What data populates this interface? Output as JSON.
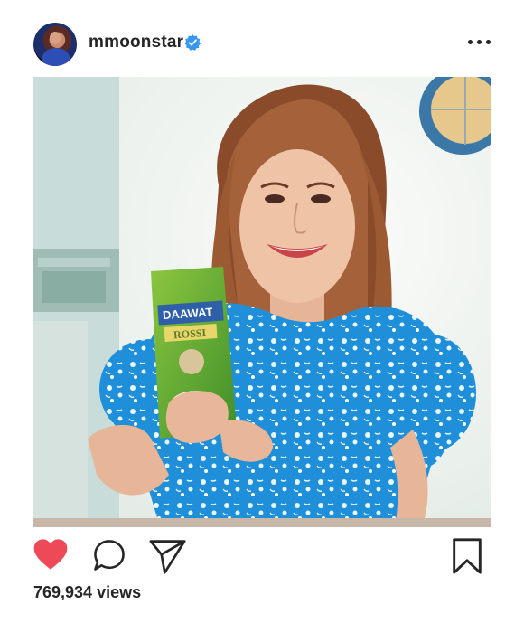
{
  "post": {
    "username": "mmoonstar",
    "verified": true,
    "views_count": "769,934",
    "views_label": "views"
  },
  "media": {
    "brand_text": "DAAWAT",
    "product_text": "ROSSI"
  },
  "icons": {
    "avatar": "profile-avatar",
    "verified": "verified-badge-icon",
    "more": "more-options-icon",
    "like": "heart-icon",
    "comment": "comment-icon",
    "share": "share-icon",
    "save": "bookmark-icon"
  },
  "colors": {
    "like": "#ed4956",
    "verified": "#3897f0",
    "text": "#262626"
  }
}
